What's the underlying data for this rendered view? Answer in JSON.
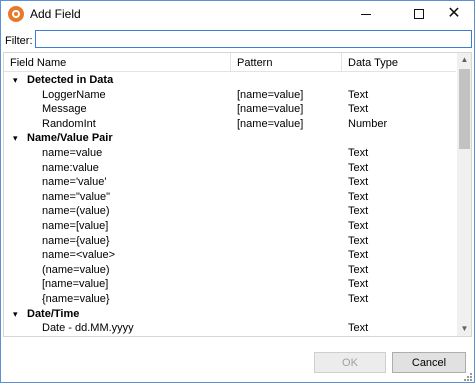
{
  "window": {
    "title": "Add Field"
  },
  "filter": {
    "label": "Filter:",
    "value": ""
  },
  "columns": {
    "name": "Field Name",
    "pattern": "Pattern",
    "type": "Data Type"
  },
  "rows": [
    {
      "group": true,
      "name": "Detected in Data"
    },
    {
      "name": "LoggerName",
      "pattern": "[name=value]",
      "type": "Text"
    },
    {
      "name": "Message",
      "pattern": "[name=value]",
      "type": "Text"
    },
    {
      "name": "RandomInt",
      "pattern": "[name=value]",
      "type": "Number"
    },
    {
      "group": true,
      "name": "Name/Value Pair"
    },
    {
      "name": "name=value",
      "pattern": "",
      "type": "Text"
    },
    {
      "name": "name:value",
      "pattern": "",
      "type": "Text"
    },
    {
      "name": "name='value'",
      "pattern": "",
      "type": "Text"
    },
    {
      "name": "name=\"value\"",
      "pattern": "",
      "type": "Text"
    },
    {
      "name": "name=(value)",
      "pattern": "",
      "type": "Text"
    },
    {
      "name": "name=[value]",
      "pattern": "",
      "type": "Text"
    },
    {
      "name": "name={value}",
      "pattern": "",
      "type": "Text"
    },
    {
      "name": "name=<value>",
      "pattern": "",
      "type": "Text"
    },
    {
      "name": "(name=value)",
      "pattern": "",
      "type": "Text"
    },
    {
      "name": "[name=value]",
      "pattern": "",
      "type": "Text"
    },
    {
      "name": "{name=value}",
      "pattern": "",
      "type": "Text"
    },
    {
      "group": true,
      "name": "Date/Time"
    },
    {
      "name": "Date - dd.MM.yyyy",
      "pattern": "",
      "type": "Text"
    }
  ],
  "buttons": {
    "ok": "OK",
    "cancel": "Cancel"
  },
  "icons": {
    "expand": "▾",
    "up": "▲",
    "down": "▼"
  },
  "colors": {
    "accent": "#3c7fd1",
    "app_icon": "#e8792b"
  }
}
